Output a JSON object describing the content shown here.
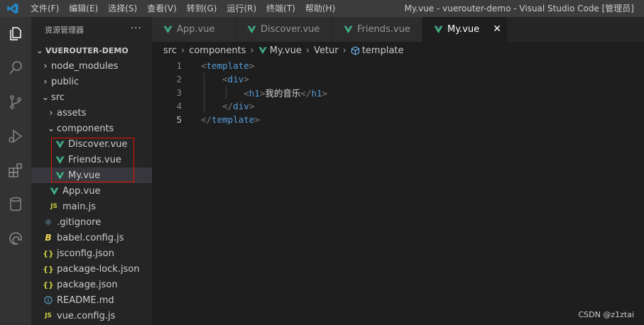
{
  "window": {
    "title": "My.vue - vuerouter-demo - Visual Studio Code [管理员]",
    "menu": [
      "文件(F)",
      "编辑(E)",
      "选择(S)",
      "查看(V)",
      "转到(G)",
      "运行(R)",
      "终端(T)",
      "帮助(H)"
    ]
  },
  "activity_bar": {
    "icons": [
      "explorer-icon",
      "search-icon",
      "source-control-icon",
      "run-debug-icon",
      "extensions-icon",
      "database-icon",
      "edge-icon"
    ]
  },
  "sidebar": {
    "title": "资源管理器",
    "more": "···",
    "tree": [
      {
        "label": "VUEROUTER-DEMO",
        "indent": 0,
        "chev": "⌄",
        "icon": "",
        "kind": "root"
      },
      {
        "label": "node_modules",
        "indent": 1,
        "chev": "›",
        "icon": "",
        "kind": "folder"
      },
      {
        "label": "public",
        "indent": 1,
        "chev": "›",
        "icon": "",
        "kind": "folder"
      },
      {
        "label": "src",
        "indent": 1,
        "chev": "⌄",
        "icon": "",
        "kind": "folder"
      },
      {
        "label": "assets",
        "indent": 2,
        "chev": "›",
        "icon": "",
        "kind": "folder"
      },
      {
        "label": "components",
        "indent": 2,
        "chev": "⌄",
        "icon": "",
        "kind": "folder"
      },
      {
        "label": "Discover.vue",
        "indent": 3,
        "chev": "",
        "icon": "vue",
        "kind": "file"
      },
      {
        "label": "Friends.vue",
        "indent": 3,
        "chev": "",
        "icon": "vue",
        "kind": "file"
      },
      {
        "label": "My.vue",
        "indent": 3,
        "chev": "",
        "icon": "vue",
        "kind": "file",
        "selected": true
      },
      {
        "label": "App.vue",
        "indent": 2,
        "chev": "",
        "icon": "vue",
        "kind": "file"
      },
      {
        "label": "main.js",
        "indent": 2,
        "chev": "",
        "icon": "js",
        "kind": "file"
      },
      {
        "label": ".gitignore",
        "indent": 1,
        "chev": "",
        "icon": "git",
        "kind": "file"
      },
      {
        "label": "babel.config.js",
        "indent": 1,
        "chev": "",
        "icon": "babel",
        "kind": "file"
      },
      {
        "label": "jsconfig.json",
        "indent": 1,
        "chev": "",
        "icon": "json",
        "kind": "file"
      },
      {
        "label": "package-lock.json",
        "indent": 1,
        "chev": "",
        "icon": "json",
        "kind": "file"
      },
      {
        "label": "package.json",
        "indent": 1,
        "chev": "",
        "icon": "json",
        "kind": "file"
      },
      {
        "label": "README.md",
        "indent": 1,
        "chev": "",
        "icon": "info",
        "kind": "file"
      },
      {
        "label": "vue.config.js",
        "indent": 1,
        "chev": "",
        "icon": "js",
        "kind": "file"
      }
    ]
  },
  "tabs": [
    {
      "label": "App.vue",
      "active": false
    },
    {
      "label": "Discover.vue",
      "active": false
    },
    {
      "label": "Friends.vue",
      "active": false
    },
    {
      "label": "My.vue",
      "active": true,
      "close": "✕"
    }
  ],
  "breadcrumb": [
    "src",
    "components",
    "My.vue",
    "Vetur",
    "template"
  ],
  "editor": {
    "lines": [
      {
        "num": "1",
        "indent": "",
        "parts": [
          [
            "b",
            "<"
          ],
          [
            "n",
            "template"
          ],
          [
            "b",
            ">"
          ]
        ]
      },
      {
        "num": "2",
        "indent": "    ",
        "parts": [
          [
            "b",
            "<"
          ],
          [
            "n",
            "div"
          ],
          [
            "b",
            ">"
          ]
        ]
      },
      {
        "num": "3",
        "indent": "        ",
        "parts": [
          [
            "b",
            "<"
          ],
          [
            "n",
            "h1"
          ],
          [
            "b",
            ">"
          ],
          [
            "t",
            "我的音乐"
          ],
          [
            "b",
            "</"
          ],
          [
            "n",
            "h1"
          ],
          [
            "b",
            ">"
          ]
        ]
      },
      {
        "num": "4",
        "indent": "    ",
        "parts": [
          [
            "b",
            "</"
          ],
          [
            "n",
            "div"
          ],
          [
            "b",
            ">"
          ]
        ]
      },
      {
        "num": "5",
        "indent": "",
        "parts": [
          [
            "b",
            "</"
          ],
          [
            "n",
            "template"
          ],
          [
            "b",
            ">"
          ]
        ],
        "current": true
      }
    ]
  },
  "watermark": "CSDN @z1ztai",
  "colors": {
    "vue_green": "#41b883",
    "js_yellow": "#cbcb41",
    "json_yellow": "#cbcb41",
    "info_blue": "#519aba",
    "highlight_red": "#e51400",
    "accent": "#007acc"
  }
}
